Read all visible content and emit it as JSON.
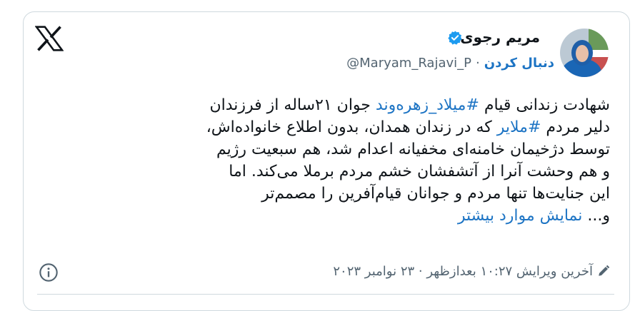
{
  "author": {
    "name": "مریم رجوی",
    "handle": "@Maryam_Rajavi_P",
    "follow_label": "دنبال کردن",
    "separator": "·"
  },
  "tweet": {
    "lines": [
      [
        "شهادت زندانی قیام ",
        "#میلاد_زهره‌وند",
        " جوان ۲۱ساله از فرزندان"
      ],
      [
        "دلیر مردم ",
        "#ملایر",
        " که در زندان همدان، بدون اطلاع خانواده‌اش،"
      ],
      [
        "توسط دژخیمان خامنه‌ای مخفیانه اعدام شد، هم سبعیت رژیم",
        "",
        ""
      ],
      [
        "و هم وحشت آنرا از آتشفشان خشم مردم برملا می‌کند. اما",
        "",
        ""
      ],
      [
        "این جنایت‌ها تنها مردم و جوانان قیام‌آفرین را مصمم‌تر",
        "",
        ""
      ]
    ],
    "ellipsis_prefix": "و... ",
    "show_more": "نمایش موارد بیشتر"
  },
  "footer": {
    "edited_text": "آخرین ویرایش ۱۰:۲۷ بعدازظهر · ۲۳ نوامبر ۲۰۲۳"
  },
  "icons": {
    "logo": "x-logo-icon",
    "verified": "verified-badge-icon",
    "edit": "pencil-icon",
    "info": "info-icon"
  },
  "colors": {
    "link": "#1d74c4",
    "verified": "#1d9bf0",
    "muted": "#536471"
  }
}
